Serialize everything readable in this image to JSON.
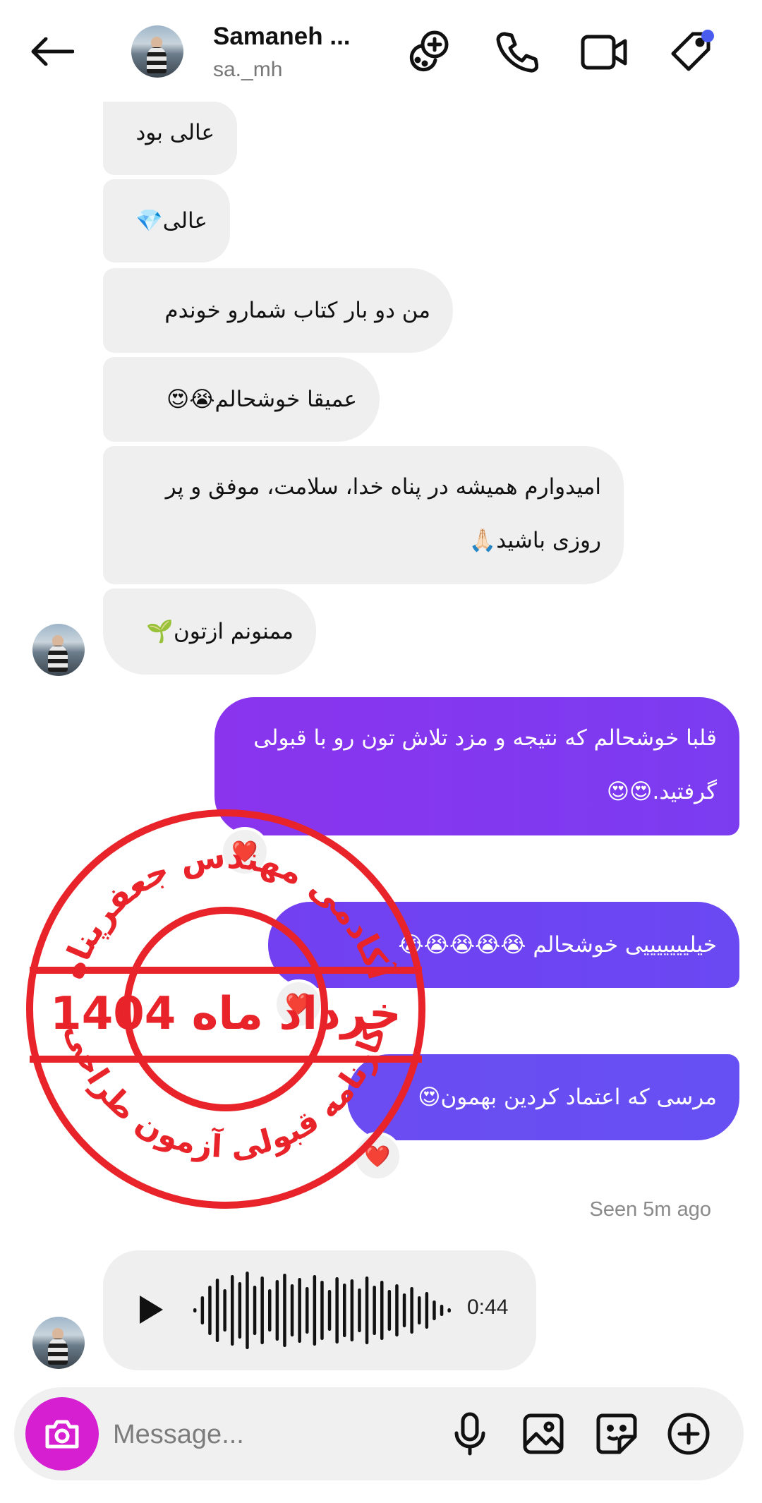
{
  "header": {
    "name": "Samaneh ...",
    "username": "sa._mh"
  },
  "messages": [
    {
      "text": "عالی بود"
    },
    {
      "text": "عالی💎"
    },
    {
      "text": "من دو بار کتاب شمارو خوندم"
    },
    {
      "text": "عمیقا خوشحالم😭😍"
    },
    {
      "text": "امیدوارم همیشه در پناه خدا، سلامت، موفق و پر روزی باشید🙏🏻"
    },
    {
      "text": "ممنونم ازتون🌱"
    },
    {
      "text": "قلبا خوشحالم که نتیجه و مزد تلاش تون رو با قبولی گرفتید.😍😍"
    },
    {
      "text": "خیلیییییییی خوشحالم 😭😭😭😭😭"
    },
    {
      "text": "مرسی که اعتماد کردین بهمون😍"
    }
  ],
  "reactions": [
    "❤️",
    "❤️",
    "❤️"
  ],
  "seen": "Seen 5m ago",
  "voice": {
    "duration": "0:44"
  },
  "composer": {
    "placeholder": "Message..."
  },
  "stamp": {
    "top_text": "آکادمی مهندس جعفرپناه",
    "middle_text": "خرداد ماه 1404",
    "bottom_text": "کارنامه قبولی آزمون طراحی",
    "color": "#e8232a"
  },
  "colors": {
    "outgoing_start": "#7b3cf0",
    "outgoing_end": "#6a4cf2",
    "incoming": "#efefef",
    "camera": "#d51fd1"
  }
}
